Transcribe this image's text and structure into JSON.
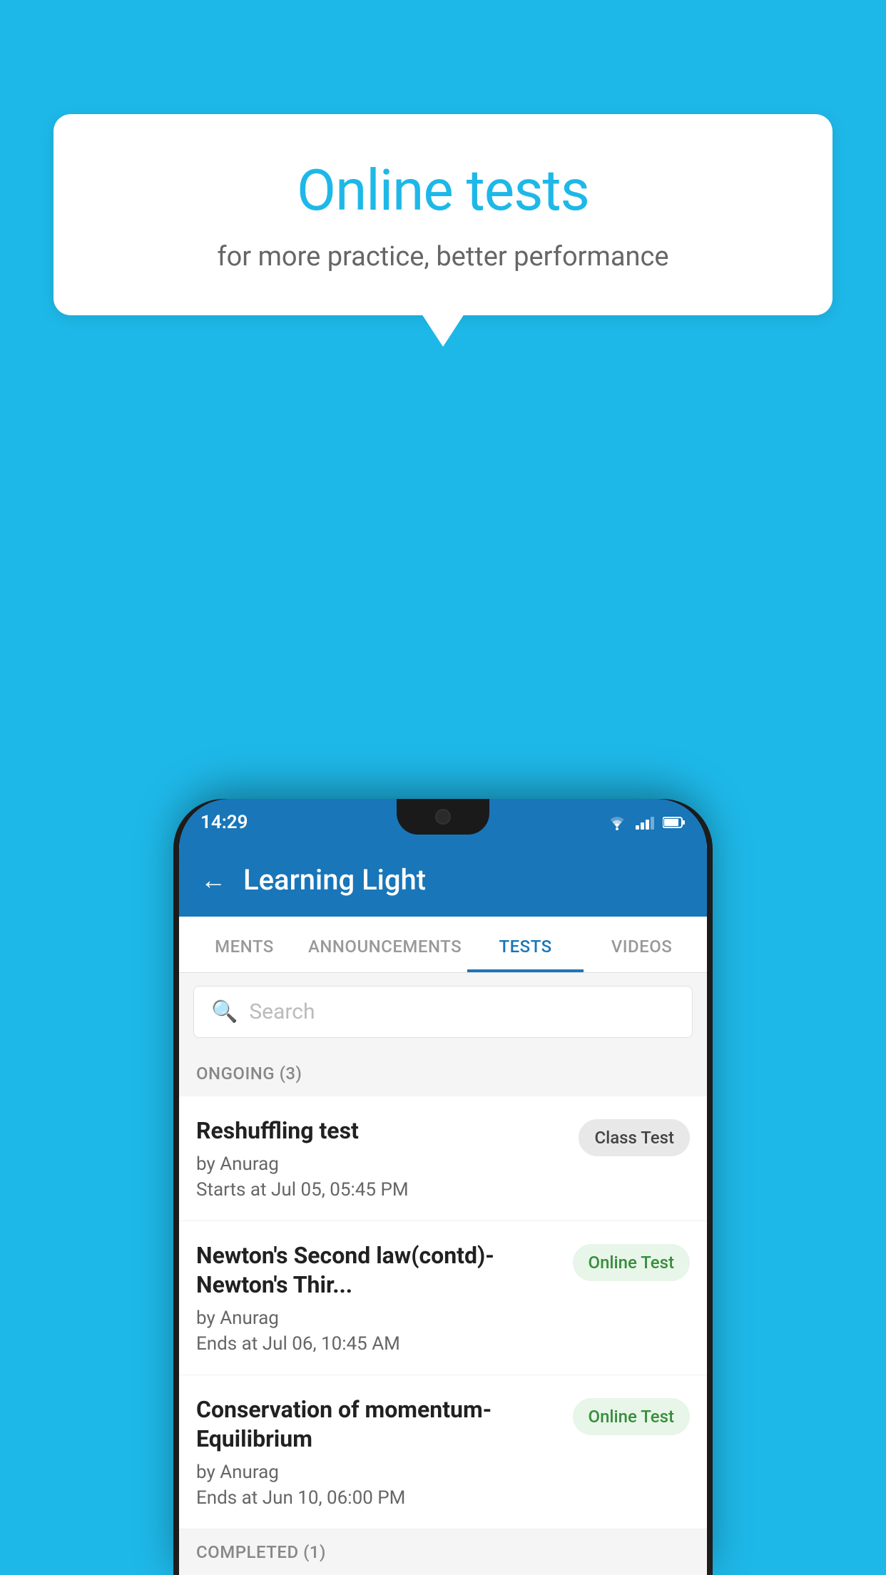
{
  "background_color": "#1eb8e8",
  "speech_bubble": {
    "title": "Online tests",
    "subtitle": "for more practice, better performance"
  },
  "status_bar": {
    "time": "14:29",
    "wifi": "▾",
    "signal": "▲",
    "battery": "▮"
  },
  "app_header": {
    "back_label": "←",
    "title": "Learning Light"
  },
  "tabs": [
    {
      "label": "MENTS",
      "active": false
    },
    {
      "label": "ANNOUNCEMENTS",
      "active": false
    },
    {
      "label": "TESTS",
      "active": true
    },
    {
      "label": "VIDEOS",
      "active": false
    }
  ],
  "search": {
    "placeholder": "Search"
  },
  "ongoing_section": {
    "label": "ONGOING (3)"
  },
  "tests": [
    {
      "name": "Reshuffling test",
      "by": "by Anurag",
      "time_label": "Starts at",
      "time": "Jul 05, 05:45 PM",
      "badge": "Class Test",
      "badge_type": "class"
    },
    {
      "name": "Newton's Second law(contd)-Newton's Thir...",
      "by": "by Anurag",
      "time_label": "Ends at",
      "time": "Jul 06, 10:45 AM",
      "badge": "Online Test",
      "badge_type": "online"
    },
    {
      "name": "Conservation of momentum-Equilibrium",
      "by": "by Anurag",
      "time_label": "Ends at",
      "time": "Jun 10, 06:00 PM",
      "badge": "Online Test",
      "badge_type": "online"
    }
  ],
  "completed_section": {
    "label": "COMPLETED (1)"
  }
}
